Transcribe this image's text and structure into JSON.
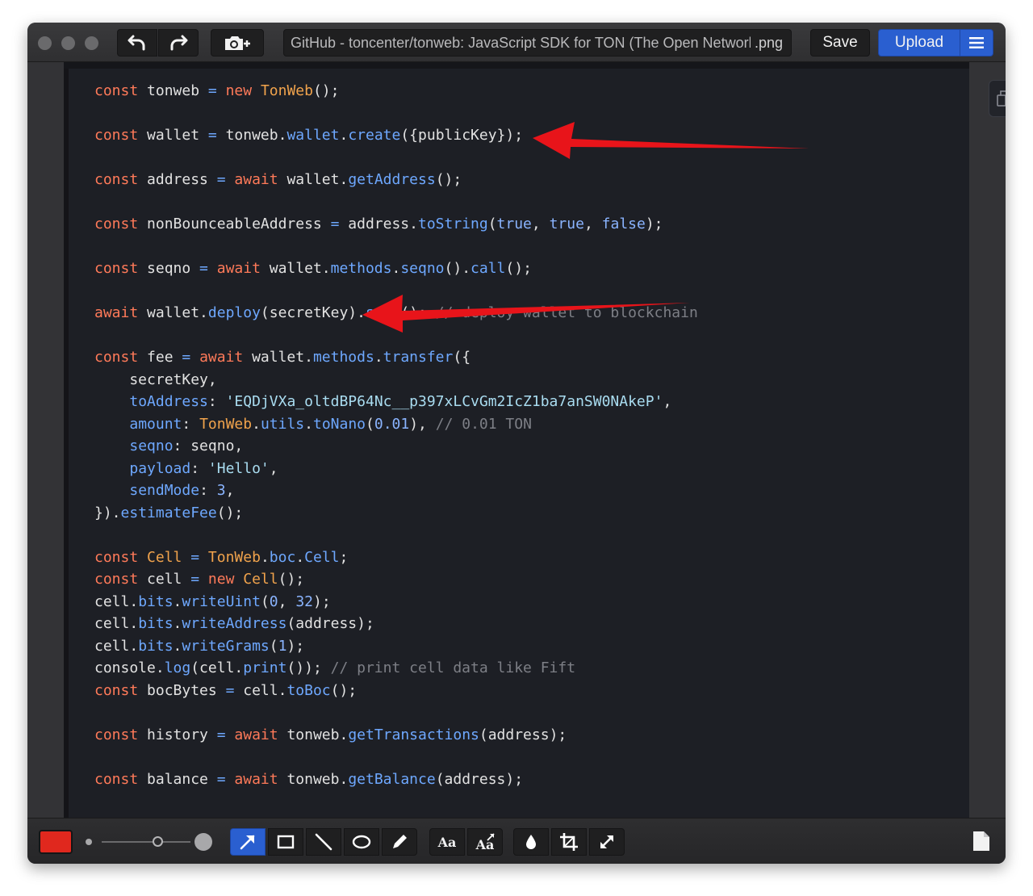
{
  "titlebar": {
    "filename": "GitHub - toncenter/tonweb: JavaScript SDK for TON (The Open Network)",
    "extension": ".png",
    "save_label": "Save",
    "upload_label": "Upload",
    "icons": [
      "undo-icon",
      "redo-icon",
      "camera-add-icon",
      "menu-icon"
    ]
  },
  "code": {
    "lines": [
      [
        {
          "t": "const",
          "c": "k"
        },
        {
          "t": " tonweb "
        },
        {
          "t": "=",
          "c": "fn"
        },
        {
          "t": " "
        },
        {
          "t": "new",
          "c": "k"
        },
        {
          "t": " "
        },
        {
          "t": "TonWeb",
          "c": "cls"
        },
        {
          "t": "();"
        }
      ],
      [],
      [
        {
          "t": "const",
          "c": "k"
        },
        {
          "t": " wallet "
        },
        {
          "t": "=",
          "c": "fn"
        },
        {
          "t": " tonweb."
        },
        {
          "t": "wallet",
          "c": "prop"
        },
        {
          "t": "."
        },
        {
          "t": "create",
          "c": "fn"
        },
        {
          "t": "({publicKey});"
        }
      ],
      [],
      [
        {
          "t": "const",
          "c": "k"
        },
        {
          "t": " address "
        },
        {
          "t": "=",
          "c": "fn"
        },
        {
          "t": " "
        },
        {
          "t": "await",
          "c": "k"
        },
        {
          "t": " wallet."
        },
        {
          "t": "getAddress",
          "c": "fn"
        },
        {
          "t": "();"
        }
      ],
      [],
      [
        {
          "t": "const",
          "c": "k"
        },
        {
          "t": " nonBounceableAddress "
        },
        {
          "t": "=",
          "c": "fn"
        },
        {
          "t": " address."
        },
        {
          "t": "toString",
          "c": "fn"
        },
        {
          "t": "("
        },
        {
          "t": "true",
          "c": "num"
        },
        {
          "t": ", "
        },
        {
          "t": "true",
          "c": "num"
        },
        {
          "t": ", "
        },
        {
          "t": "false",
          "c": "num"
        },
        {
          "t": ");"
        }
      ],
      [],
      [
        {
          "t": "const",
          "c": "k"
        },
        {
          "t": " seqno "
        },
        {
          "t": "=",
          "c": "fn"
        },
        {
          "t": " "
        },
        {
          "t": "await",
          "c": "k"
        },
        {
          "t": " wallet."
        },
        {
          "t": "methods",
          "c": "prop"
        },
        {
          "t": "."
        },
        {
          "t": "seqno",
          "c": "fn"
        },
        {
          "t": "()."
        },
        {
          "t": "call",
          "c": "fn"
        },
        {
          "t": "();"
        }
      ],
      [],
      [
        {
          "t": "await",
          "c": "k"
        },
        {
          "t": " wallet."
        },
        {
          "t": "deploy",
          "c": "fn"
        },
        {
          "t": "(secretKey)."
        },
        {
          "t": "send",
          "c": "fn"
        },
        {
          "t": "(); "
        },
        {
          "t": "// deploy wallet to blockchain",
          "c": "cm"
        }
      ],
      [],
      [
        {
          "t": "const",
          "c": "k"
        },
        {
          "t": " fee "
        },
        {
          "t": "=",
          "c": "fn"
        },
        {
          "t": " "
        },
        {
          "t": "await",
          "c": "k"
        },
        {
          "t": " wallet."
        },
        {
          "t": "methods",
          "c": "prop"
        },
        {
          "t": "."
        },
        {
          "t": "transfer",
          "c": "fn"
        },
        {
          "t": "({"
        }
      ],
      [
        {
          "t": "    secretKey,"
        }
      ],
      [
        {
          "t": "    "
        },
        {
          "t": "toAddress",
          "c": "prop"
        },
        {
          "t": ": "
        },
        {
          "t": "'EQDjVXa_oltdBP64Nc__p397xLCvGm2IcZ1ba7anSW0NAkeP'",
          "c": "str"
        },
        {
          "t": ","
        }
      ],
      [
        {
          "t": "    "
        },
        {
          "t": "amount",
          "c": "prop"
        },
        {
          "t": ": "
        },
        {
          "t": "TonWeb",
          "c": "cls"
        },
        {
          "t": "."
        },
        {
          "t": "utils",
          "c": "prop"
        },
        {
          "t": "."
        },
        {
          "t": "toNano",
          "c": "fn"
        },
        {
          "t": "("
        },
        {
          "t": "0.01",
          "c": "num"
        },
        {
          "t": "), "
        },
        {
          "t": "// 0.01 TON",
          "c": "cm"
        }
      ],
      [
        {
          "t": "    "
        },
        {
          "t": "seqno",
          "c": "prop"
        },
        {
          "t": ": seqno,"
        }
      ],
      [
        {
          "t": "    "
        },
        {
          "t": "payload",
          "c": "prop"
        },
        {
          "t": ": "
        },
        {
          "t": "'Hello'",
          "c": "str"
        },
        {
          "t": ","
        }
      ],
      [
        {
          "t": "    "
        },
        {
          "t": "sendMode",
          "c": "prop"
        },
        {
          "t": ": "
        },
        {
          "t": "3",
          "c": "num"
        },
        {
          "t": ","
        }
      ],
      [
        {
          "t": "})."
        },
        {
          "t": "estimateFee",
          "c": "fn"
        },
        {
          "t": "();"
        }
      ],
      [],
      [
        {
          "t": "const",
          "c": "k"
        },
        {
          "t": " "
        },
        {
          "t": "Cell",
          "c": "cls"
        },
        {
          "t": " "
        },
        {
          "t": "=",
          "c": "fn"
        },
        {
          "t": " "
        },
        {
          "t": "TonWeb",
          "c": "cls"
        },
        {
          "t": "."
        },
        {
          "t": "boc",
          "c": "prop"
        },
        {
          "t": "."
        },
        {
          "t": "Cell",
          "c": "prop"
        },
        {
          "t": ";"
        }
      ],
      [
        {
          "t": "const",
          "c": "k"
        },
        {
          "t": " cell "
        },
        {
          "t": "=",
          "c": "fn"
        },
        {
          "t": " "
        },
        {
          "t": "new",
          "c": "k"
        },
        {
          "t": " "
        },
        {
          "t": "Cell",
          "c": "cls"
        },
        {
          "t": "();"
        }
      ],
      [
        {
          "t": "cell."
        },
        {
          "t": "bits",
          "c": "prop"
        },
        {
          "t": "."
        },
        {
          "t": "writeUint",
          "c": "fn"
        },
        {
          "t": "("
        },
        {
          "t": "0",
          "c": "num"
        },
        {
          "t": ", "
        },
        {
          "t": "32",
          "c": "num"
        },
        {
          "t": ");"
        }
      ],
      [
        {
          "t": "cell."
        },
        {
          "t": "bits",
          "c": "prop"
        },
        {
          "t": "."
        },
        {
          "t": "writeAddress",
          "c": "fn"
        },
        {
          "t": "(address);"
        }
      ],
      [
        {
          "t": "cell."
        },
        {
          "t": "bits",
          "c": "prop"
        },
        {
          "t": "."
        },
        {
          "t": "writeGrams",
          "c": "fn"
        },
        {
          "t": "("
        },
        {
          "t": "1",
          "c": "num"
        },
        {
          "t": ");"
        }
      ],
      [
        {
          "t": "console."
        },
        {
          "t": "log",
          "c": "fn"
        },
        {
          "t": "(cell."
        },
        {
          "t": "print",
          "c": "fn"
        },
        {
          "t": "()); "
        },
        {
          "t": "// print cell data like Fift",
          "c": "cm"
        }
      ],
      [
        {
          "t": "const",
          "c": "k"
        },
        {
          "t": " bocBytes "
        },
        {
          "t": "=",
          "c": "fn"
        },
        {
          "t": " cell."
        },
        {
          "t": "toBoc",
          "c": "fn"
        },
        {
          "t": "();"
        }
      ],
      [],
      [
        {
          "t": "const",
          "c": "k"
        },
        {
          "t": " history "
        },
        {
          "t": "=",
          "c": "fn"
        },
        {
          "t": " "
        },
        {
          "t": "await",
          "c": "k"
        },
        {
          "t": " tonweb."
        },
        {
          "t": "getTransactions",
          "c": "fn"
        },
        {
          "t": "(address);"
        }
      ],
      [],
      [
        {
          "t": "const",
          "c": "k"
        },
        {
          "t": " balance "
        },
        {
          "t": "=",
          "c": "fn"
        },
        {
          "t": " "
        },
        {
          "t": "await",
          "c": "k"
        },
        {
          "t": " tonweb."
        },
        {
          "t": "getBalance",
          "c": "fn"
        },
        {
          "t": "(address);"
        }
      ]
    ]
  },
  "annotations": {
    "arrow_color": "#e8141a"
  },
  "toolbar": {
    "active_color": "#e0281e",
    "active_tool": "arrow-tool",
    "text_tool_label": "Aa",
    "text_style_tool_label": "Aa",
    "tools": [
      "arrow-tool",
      "rectangle-tool",
      "line-tool",
      "ellipse-tool",
      "pencil-tool",
      "text-tool",
      "text-style-tool",
      "blur-tool",
      "crop-tool",
      "resize-tool"
    ]
  }
}
